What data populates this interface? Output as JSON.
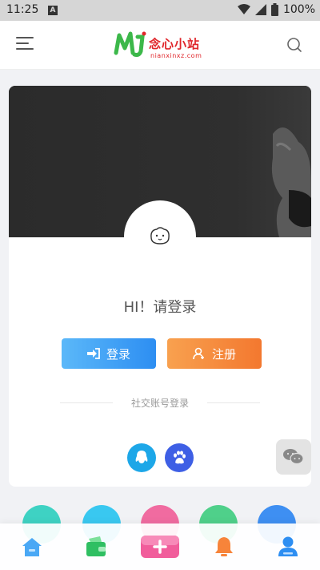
{
  "status_bar": {
    "time": "11:25",
    "notification_icon": "A",
    "battery": "100%"
  },
  "header": {
    "logo_text": "念心小站",
    "logo_domain": "nianxinxz.com"
  },
  "profile": {
    "greeting": "HI！请登录",
    "login_label": "登录",
    "register_label": "注册",
    "social_login_label": "社交账号登录"
  },
  "colors": {
    "accent_blue": "#2d8ef2",
    "accent_orange": "#f3782f",
    "brand_red": "#e0262b",
    "brand_green": "#3cb84a"
  },
  "icons": {
    "menu": "menu-icon",
    "search": "search-icon",
    "qq": "qq-icon",
    "baidu": "baidu-paw-icon",
    "wechat": "wechat-icon"
  },
  "tabbar": [
    "home-icon",
    "wallet-icon",
    "add-icon",
    "bell-icon",
    "user-icon"
  ]
}
